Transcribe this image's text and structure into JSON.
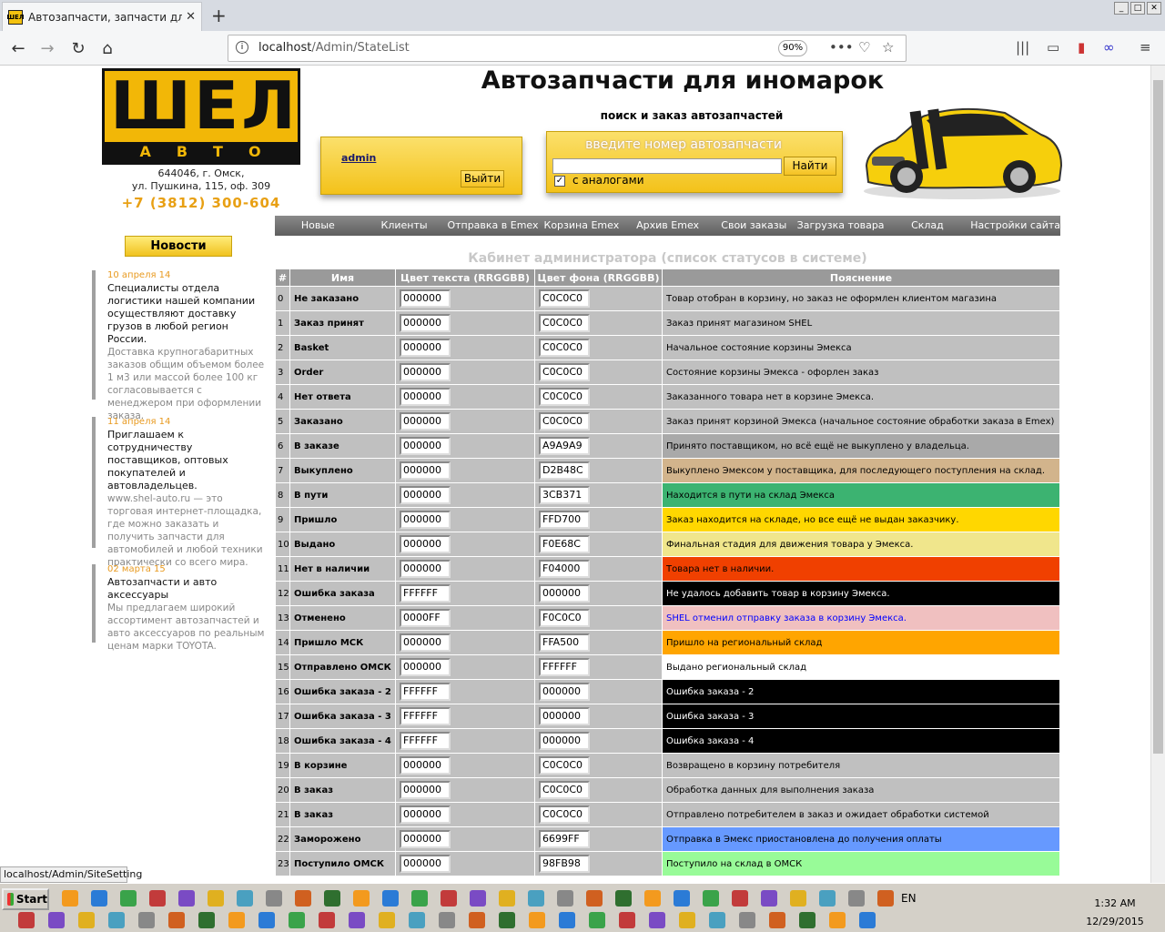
{
  "browser": {
    "tab_title": "Автозапчасти, запчасти для ино",
    "tab_close": "✕",
    "new_tab": "+",
    "url_host": "localhost",
    "url_path": "/Admin/StateList",
    "zoom": "90%",
    "status_url": "localhost/Admin/SiteSetting"
  },
  "header": {
    "logo_big": "ШЕЛ",
    "logo_small": "АВТО",
    "address_line1": "644046, г. Омск,",
    "address_line2": "ул. Пушкина, 115, оф. 309",
    "phone": "+7 (3812) 300-604",
    "site_title": "Автозапчасти для иномарок",
    "subtitle": "поиск и заказ автозапчастей",
    "user": "admin",
    "logout_label": "Выйти",
    "search_placeholder": "введите номер автозапчасти",
    "search_button": "Найти",
    "analogs_label": "с аналогами",
    "analogs_check": "✓"
  },
  "menu": [
    "Новые",
    "Клиенты",
    "Отправка в Emex",
    "Корзина Emex",
    "Архив Emex",
    "Свои заказы",
    "Загрузка товара",
    "Склад",
    "Настройки сайта"
  ],
  "sidebar": {
    "news_button": "Новости",
    "news": [
      {
        "date": "10 апреля 14",
        "headline": "Специалисты отдела логистики нашей компании осуществляют доставку грузов в любой регион России.",
        "body": "Доставка крупногабаритных заказов общим объемом более 1 м3 или массой более 100 кг согласовывается с менеджером при оформлении заказа."
      },
      {
        "date": "11 апреля 14",
        "headline": "Приглашаем к сотрудничеству поставщиков, оптовых покупателей и автовладельцев.",
        "body": "www.shel-auto.ru — это торговая интернет-площадка, где можно заказать и получить запчасти для автомобилей и любой техники практически со всего мира."
      },
      {
        "date": "02 марта 15",
        "headline": "Автозапчасти и авто аксессуары",
        "body": "Мы предлагаем широкий ассортимент автозапчастей и авто аксессуаров по реальным ценам марки TOYOTA."
      }
    ]
  },
  "cabinet_title": "Кабинет администратора (список статусов в системе)",
  "table": {
    "headers": [
      "#",
      "Имя",
      "Цвет текста (RRGGBB)",
      "Цвет фона (RRGGBB)",
      "Пояснение"
    ],
    "rows": [
      {
        "n": "0",
        "name": "Не заказано",
        "fg": "000000",
        "bg": "C0C0C0",
        "desc": "Товар отобран в корзину, но заказ не оформлен клиентом магазина"
      },
      {
        "n": "1",
        "name": "Заказ принят",
        "fg": "000000",
        "bg": "C0C0C0",
        "desc": "Заказ принят магазином SHEL"
      },
      {
        "n": "2",
        "name": "Basket",
        "fg": "000000",
        "bg": "C0C0C0",
        "desc": "Начальное состояние корзины Эмекса"
      },
      {
        "n": "3",
        "name": "Order",
        "fg": "000000",
        "bg": "C0C0C0",
        "desc": "Состояние корзины Эмекса - офорлен заказ"
      },
      {
        "n": "4",
        "name": "Нет ответа",
        "fg": "000000",
        "bg": "C0C0C0",
        "desc": "Заказанного товара нет в корзине Эмекса."
      },
      {
        "n": "5",
        "name": "Заказано",
        "fg": "000000",
        "bg": "C0C0C0",
        "desc": "Заказ принят корзиной Эмекса (начальное состояние обработки заказа в Emex)"
      },
      {
        "n": "6",
        "name": "В заказе",
        "fg": "000000",
        "bg": "A9A9A9",
        "desc": "Принято поставщиком, но всё ещё не выкуплено у владельца."
      },
      {
        "n": "7",
        "name": "Выкуплено",
        "fg": "000000",
        "bg": "D2B48C",
        "desc": "Выкуплено Эмексом у поставщика, для последующего поступления на склад."
      },
      {
        "n": "8",
        "name": "В пути",
        "fg": "000000",
        "bg": "3CB371",
        "desc": "Находится в пути на склад Эмекса"
      },
      {
        "n": "9",
        "name": "Пришло",
        "fg": "000000",
        "bg": "FFD700",
        "desc": "Заказ находится на складе, но все ещё не выдан заказчику."
      },
      {
        "n": "10",
        "name": "Выдано",
        "fg": "000000",
        "bg": "F0E68C",
        "desc": "Финальная стадия для движения товара у Эмекса."
      },
      {
        "n": "11",
        "name": "Нет в наличии",
        "fg": "000000",
        "bg": "F04000",
        "desc": "Товара нет в наличии."
      },
      {
        "n": "12",
        "name": "Ошибка заказа",
        "fg": "FFFFFF",
        "bg": "000000",
        "desc": "Не удалось добавить товар в корзину Эмекса."
      },
      {
        "n": "13",
        "name": "Отменено",
        "fg": "0000FF",
        "bg": "F0C0C0",
        "desc": "SHEL отменил отправку заказа в корзину Эмекса."
      },
      {
        "n": "14",
        "name": "Пришло МСК",
        "fg": "000000",
        "bg": "FFA500",
        "desc": "Пришло на региональный склад"
      },
      {
        "n": "15",
        "name": "Отправлено ОМСК",
        "fg": "000000",
        "bg": "FFFFFF",
        "desc": "Выдано региональный склад"
      },
      {
        "n": "16",
        "name": "Ошибка заказа - 2",
        "fg": "FFFFFF",
        "bg": "000000",
        "desc": "Ошибка заказа - 2"
      },
      {
        "n": "17",
        "name": "Ошибка заказа - 3",
        "fg": "FFFFFF",
        "bg": "000000",
        "desc": "Ошибка заказа - 3"
      },
      {
        "n": "18",
        "name": "Ошибка заказа - 4",
        "fg": "FFFFFF",
        "bg": "000000",
        "desc": "Ошибка заказа - 4"
      },
      {
        "n": "19",
        "name": "В корзине",
        "fg": "000000",
        "bg": "C0C0C0",
        "desc": "Возвращено в корзину потребителя"
      },
      {
        "n": "20",
        "name": "В заказ",
        "fg": "000000",
        "bg": "C0C0C0",
        "desc": "Обработка данных для выполнения заказа"
      },
      {
        "n": "21",
        "name": "В заказ",
        "fg": "000000",
        "bg": "C0C0C0",
        "desc": "Отправлено потребителем в заказ и ожидает обработки системой"
      },
      {
        "n": "22",
        "name": "Заморожено",
        "fg": "000000",
        "bg": "6699FF",
        "desc": "Отправка в Эмекс приостановлена до получения оплаты"
      },
      {
        "n": "23",
        "name": "Поступило ОМСК",
        "fg": "000000",
        "bg": "98FB98",
        "desc": "Поступило на склад в ОМСК"
      }
    ]
  },
  "taskbar": {
    "start": "Start",
    "lang": "EN",
    "time": "1:32 AM",
    "date": "12/29/2015"
  },
  "colors": {
    "brand_yellow": "#f2b707",
    "menu_gray": "#6e6e6e",
    "header_gray": "#9a9a9a"
  }
}
